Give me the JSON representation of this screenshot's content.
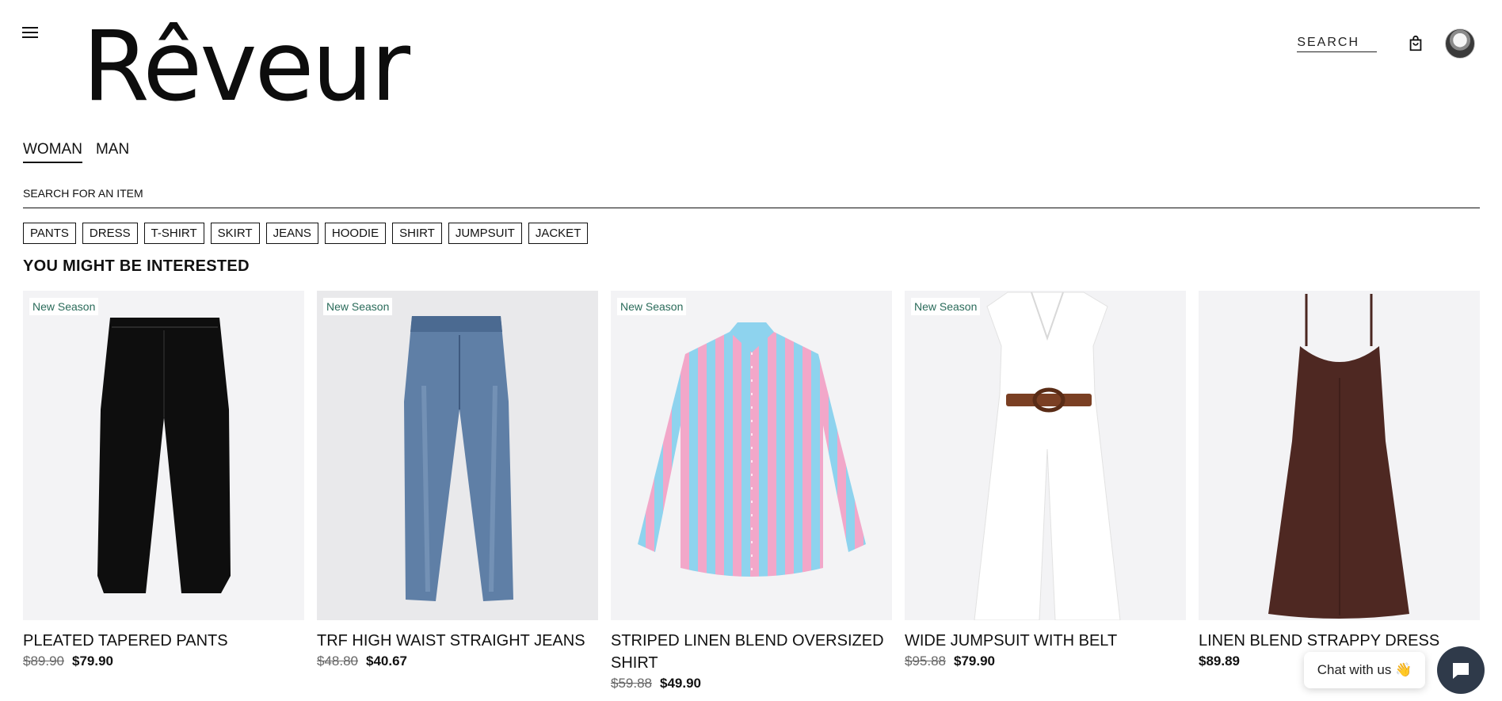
{
  "header": {
    "logo": "Rêveur",
    "search_link": "SEARCH",
    "icons": {
      "menu": "menu-icon",
      "bag": "shopping-bag-icon",
      "avatar": "user-avatar"
    }
  },
  "gender_tabs": [
    {
      "label": "WOMAN",
      "active": true
    },
    {
      "label": "MAN",
      "active": false
    }
  ],
  "search": {
    "placeholder": "SEARCH FOR AN ITEM",
    "value": ""
  },
  "categories": [
    "PANTS",
    "DRESS",
    "T-SHIRT",
    "SKIRT",
    "JEANS",
    "HOODIE",
    "SHIRT",
    "JUMPSUIT",
    "JACKET"
  ],
  "section_title": "YOU MIGHT BE INTERESTED",
  "products": [
    {
      "badge": "New Season",
      "name": "PLEATED TAPERED PANTS",
      "old_price": "$89.90",
      "price": "$79.90"
    },
    {
      "badge": "New Season",
      "name": "TRF HIGH WAIST STRAIGHT JEANS",
      "old_price": "$48.80",
      "price": "$40.67"
    },
    {
      "badge": "New Season",
      "name": "STRIPED LINEN BLEND OVERSIZED SHIRT",
      "old_price": "$59.88",
      "price": "$49.90"
    },
    {
      "badge": "New Season",
      "name": "WIDE JUMPSUIT WITH BELT",
      "old_price": "$95.88",
      "price": "$79.90"
    },
    {
      "badge": "",
      "name": "LINEN BLEND STRAPPY DRESS",
      "old_price": "",
      "price": "$89.89"
    }
  ],
  "chat": {
    "label": "Chat with us 👋"
  },
  "colors": {
    "badge_text": "#2a6b5a",
    "chat_button": "#2f3a4a",
    "image_bg": "#f3f3f5"
  }
}
